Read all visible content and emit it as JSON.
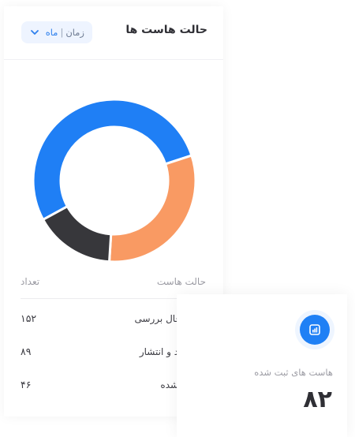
{
  "card": {
    "title": "حالت هاست ها",
    "filter": {
      "label": "زمان",
      "separator": "|",
      "value": "ماه"
    }
  },
  "chart_data": {
    "type": "pie",
    "categories": [
      "درحال بررسی",
      "تایید و انتشار",
      "رد شده"
    ],
    "values": [
      152,
      89,
      46
    ],
    "colors": [
      "#1f7ff5",
      "#f99a63",
      "#37373b"
    ]
  },
  "table": {
    "headers": {
      "status": "حالت هاست",
      "count": "تعداد"
    },
    "rows": [
      {
        "label": "درحال بررسی",
        "count": "۱۵۲",
        "color": "#1f7ff5"
      },
      {
        "label": "تایید و انتشار",
        "count": "۸۹",
        "color": "#f99a63"
      },
      {
        "label": "رد شده",
        "count": "۴۶",
        "color": "#37373b"
      }
    ]
  },
  "stat": {
    "icon": "chart-icon",
    "label": "هاست های ثبت شده",
    "value": "۸۲"
  }
}
